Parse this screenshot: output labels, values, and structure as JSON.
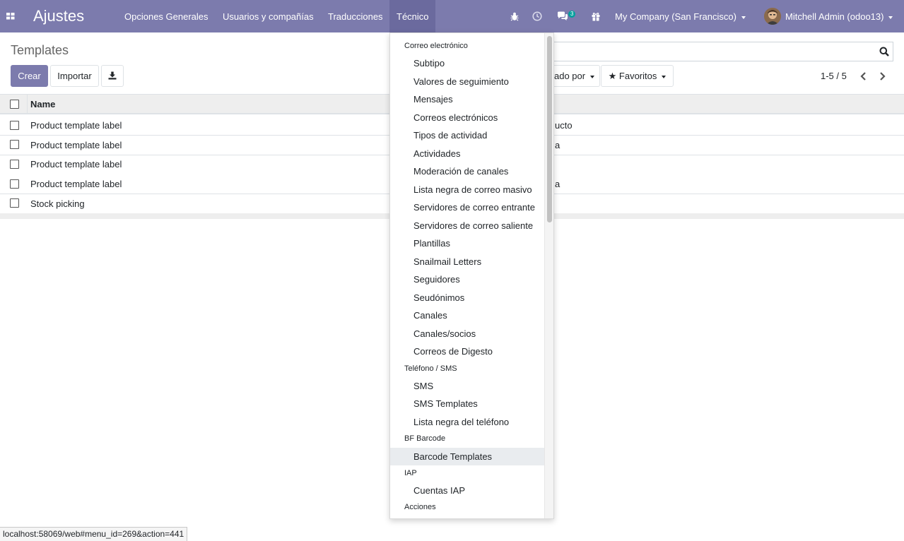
{
  "navbar": {
    "brand": "Ajustes",
    "menu": [
      {
        "label": "Opciones Generales"
      },
      {
        "label": "Usuarios y compañías"
      },
      {
        "label": "Traducciones"
      },
      {
        "label": "Técnico"
      }
    ],
    "messages_badge": "3",
    "company": "My Company (San Francisco)",
    "user": "Mitchell Admin (odoo13)"
  },
  "control_panel": {
    "title": "Templates",
    "create_label": "Crear",
    "import_label": "Importar",
    "groupby_label": "ado por",
    "favorites_label": "Favoritos",
    "pager": "1-5 / 5"
  },
  "table": {
    "header_name": "Name",
    "rows": [
      {
        "name": "Product template label",
        "right": "ucto"
      },
      {
        "name": "Product template label",
        "right": "a"
      },
      {
        "name": "Product template label",
        "right": ""
      },
      {
        "name": "Product template label",
        "right": "a"
      },
      {
        "name": "Stock picking",
        "right": ""
      }
    ]
  },
  "dropdown": {
    "sections": [
      {
        "header": "Correo electrónico",
        "items": [
          "Subtipo",
          "Valores de seguimiento",
          "Mensajes",
          "Correos electrónicos",
          "Tipos de actividad",
          "Actividades",
          "Moderación de canales",
          "Lista negra de correo masivo",
          "Servidores de correo entrante",
          "Servidores de correo saliente",
          "Plantillas",
          "Snailmail Letters",
          "Seguidores",
          "Seudónimos",
          "Canales",
          "Canales/socios",
          "Correos de Digesto"
        ]
      },
      {
        "header": "Teléfono / SMS",
        "items": [
          "SMS",
          "SMS Templates",
          "Lista negra del teléfono"
        ]
      },
      {
        "header": "BF Barcode",
        "items": [
          "Barcode Templates"
        ]
      },
      {
        "header": "IAP",
        "items": [
          "Cuentas IAP"
        ]
      },
      {
        "header": "Acciones",
        "items": []
      }
    ],
    "hovered_item": "Barcode Templates"
  },
  "statusbar": "localhost:58069/web#menu_id=269&action=441",
  "colors": {
    "brand": "#7c7bad",
    "badge": "#00a09d"
  }
}
